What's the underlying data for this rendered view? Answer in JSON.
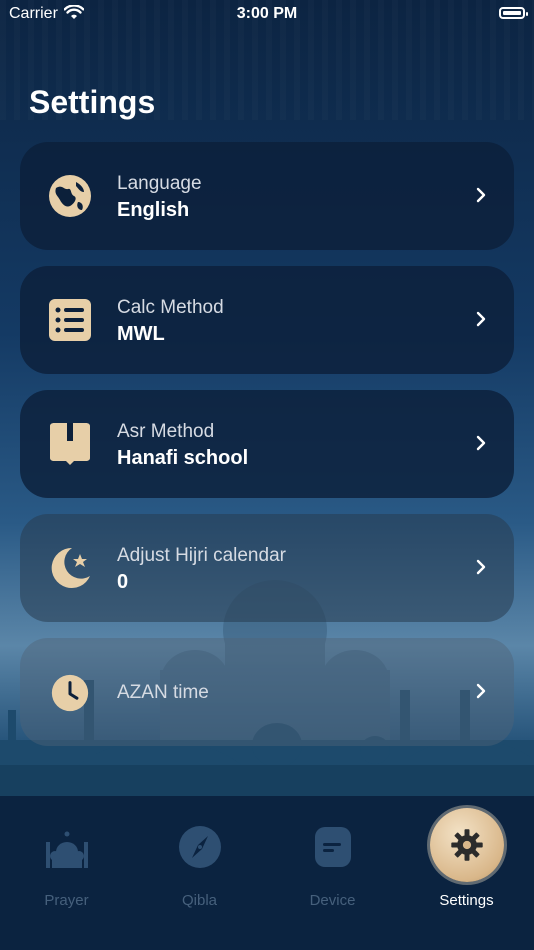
{
  "status_bar": {
    "carrier": "Carrier",
    "time": "3:00 PM"
  },
  "page": {
    "title": "Settings"
  },
  "settings": [
    {
      "label": "Language",
      "value": "English",
      "icon": "globe-icon"
    },
    {
      "label": "Calc Method",
      "value": "MWL",
      "icon": "list-icon"
    },
    {
      "label": "Asr Method",
      "value": "Hanafi school",
      "icon": "book-icon"
    },
    {
      "label": "Adjust Hijri calendar",
      "value": "0",
      "icon": "crescent-star-icon"
    },
    {
      "label": "AZAN time",
      "value": "",
      "icon": "clock-icon"
    }
  ],
  "tabs": [
    {
      "label": "Prayer",
      "icon": "mosque-icon",
      "active": false
    },
    {
      "label": "Qibla",
      "icon": "compass-icon",
      "active": false
    },
    {
      "label": "Device",
      "icon": "device-icon",
      "active": false
    },
    {
      "label": "Settings",
      "icon": "gear-icon",
      "active": true
    }
  ],
  "colors": {
    "accent_gold": "#d9b78a",
    "card_bg": "#0c203a",
    "tab_inactive": "#46607c",
    "tabbar_bg": "#0b2340"
  }
}
